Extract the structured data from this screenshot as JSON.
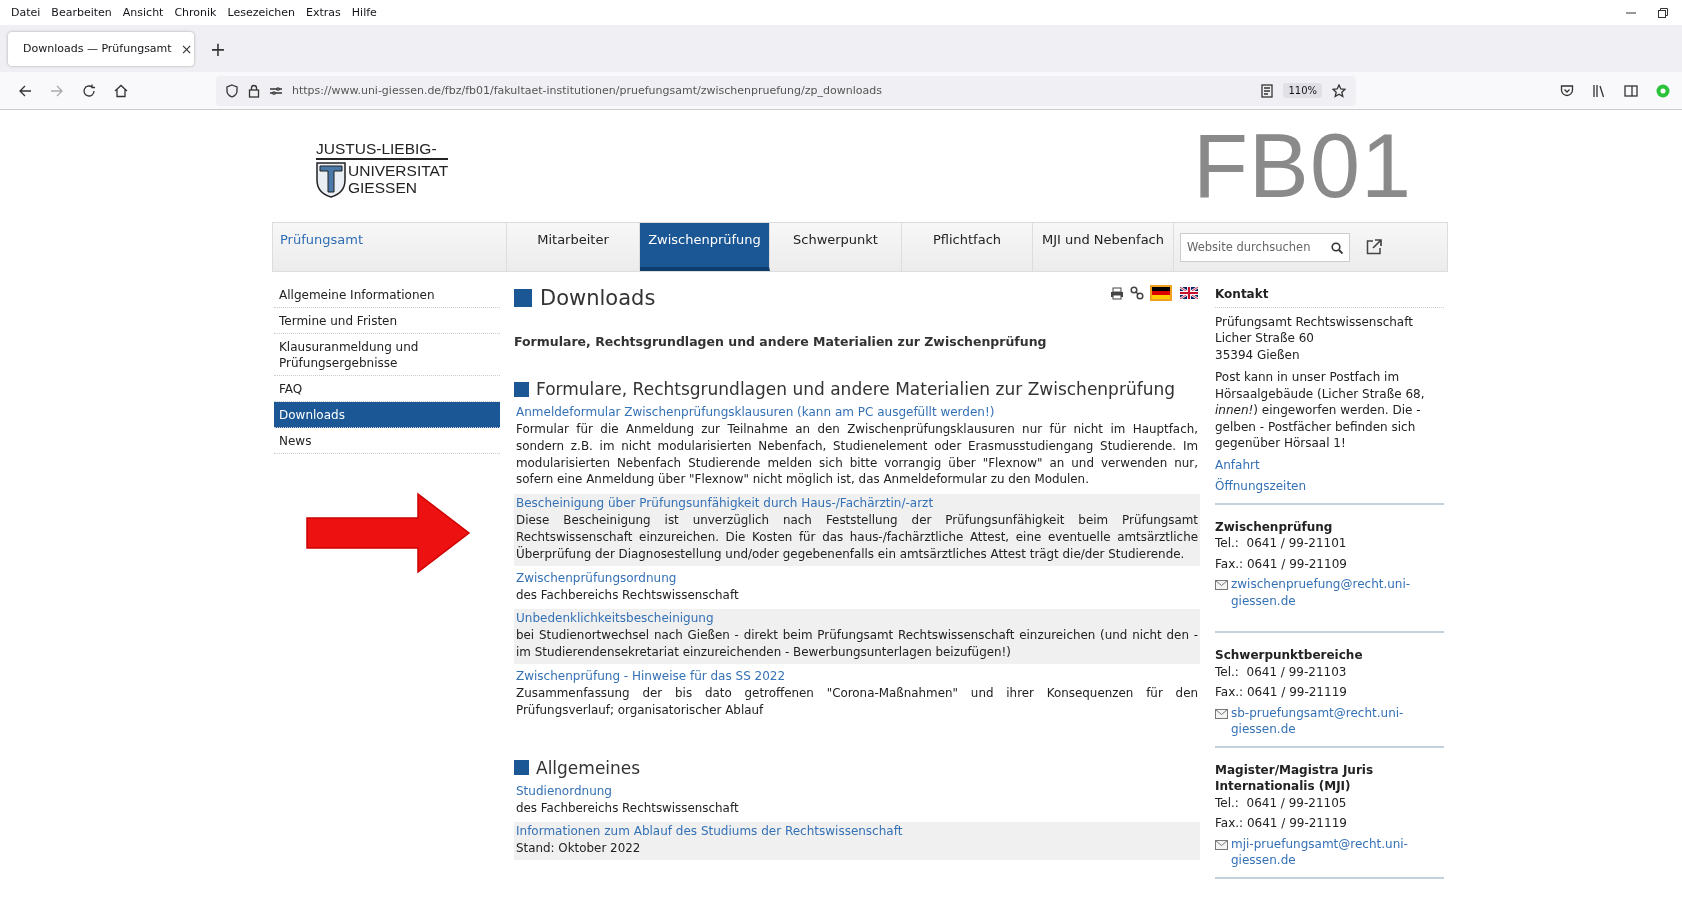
{
  "browser": {
    "menu": [
      "Datei",
      "Bearbeiten",
      "Ansicht",
      "Chronik",
      "Lesezeichen",
      "Extras",
      "Hilfe"
    ],
    "tab": {
      "title": "Downloads — Prüfungsamt",
      "close": "×",
      "selected": true
    },
    "new_tab": "+",
    "url": "https://www.uni-giessen.de/fbz/fb01/fakultaet-institutionen/pruefungsamt/zwischenpruefung/zp_downloads",
    "zoom": "110%"
  },
  "header": {
    "logo_lines": [
      "JUSTUS-LIEBIG-",
      "UNIVERSITAT",
      "GIESSEN"
    ],
    "department": "FB01"
  },
  "nav": {
    "items": [
      {
        "label": "Prüfungsamt",
        "kind": "home",
        "selected": false
      },
      {
        "label": "Mitarbeiter",
        "kind": "tab",
        "selected": false
      },
      {
        "label": "Zwischenprüfung",
        "kind": "tab",
        "selected": true
      },
      {
        "label": "Schwerpunkt",
        "kind": "tab",
        "selected": false
      },
      {
        "label": "Pflichtfach",
        "kind": "tab",
        "selected": false
      },
      {
        "label": "MJI und Nebenfach",
        "kind": "tab",
        "selected": false
      }
    ],
    "search": {
      "placeholder": "Website durchsuchen"
    }
  },
  "sidebar": {
    "items": [
      {
        "label": "Allgemeine Informationen",
        "selected": false
      },
      {
        "label": "Termine und Fristen",
        "selected": false
      },
      {
        "label": "Klausuranmeldung und Prüfungsergebnisse",
        "selected": false
      },
      {
        "label": "FAQ",
        "selected": false
      },
      {
        "label": "Downloads",
        "selected": true
      },
      {
        "label": "News",
        "selected": false
      }
    ]
  },
  "page": {
    "title": "Downloads",
    "languages": [
      {
        "kind": "de",
        "selected": true
      },
      {
        "kind": "en",
        "selected": false
      }
    ],
    "intro": "Formulare, Rechtsgrundlagen und andere Materialien zur Zwischenprüfung",
    "sections": [
      {
        "heading": "Formulare, Rechtsgrundlagen und andere Materialien zur Zwischenprüfung",
        "entries": [
          {
            "link": "Anmeldeformular Zwischenprüfungsklausuren (kann am PC ausgefüllt werden!)",
            "description": "Formular für die Anmeldung zur Teilnahme an den Zwischenprüfungsklausuren nur für nicht im Hauptfach, sondern z.B. im nicht modularisierten Nebenfach, Studienelement oder Erasmusstudiengang Studierende. Im modularisierten Nebenfach Studierende melden sich bitte vorrangig über \"Flexnow\" an und verwenden nur, sofern eine Anmeldung über \"Flexnow\" nicht möglich ist, das Anmeldeformular zu den Modulen."
          },
          {
            "link": "Bescheinigung über Prüfungsunfähigkeit durch Haus-/Fachärztin/-arzt",
            "description": "Diese Bescheinigung ist unverzüglich nach Feststellung der Prüfungsunfähigkeit beim Prüfungsamt Rechtswissenschaft einzureichen. Die Kosten für das haus-/fachärztliche Attest, eine eventuelle amtsärztliche Überprüfung der Diagnosestellung und/oder gegebenenfalls ein amtsärztliches Attest trägt die/der Studierende."
          },
          {
            "link": "Zwischenprüfungsordnung",
            "description": "des Fachbereichs Rechtswissenschaft"
          },
          {
            "link": "Unbedenklichkeitsbescheinigung",
            "description": "bei Studienortwechsel nach Gießen - direkt beim Prüfungsamt Rechtswissenschaft einzureichen (und nicht den - im Studierendensekretariat einzureichenden - Bewerbungsunterlagen beizufügen!)"
          },
          {
            "link": "Zwischenprüfung - Hinweise für das SS 2022",
            "description": "Zusammenfassung der bis dato getroffenen \"Corona-Maßnahmen\" und ihrer Konsequenzen für den Prüfungsverlauf; organisatorischer Ablauf"
          }
        ]
      },
      {
        "heading": "Allgemeines",
        "entries": [
          {
            "link": "Studienordnung",
            "description": "des Fachbereichs Rechtswissenschaft"
          },
          {
            "link": "Informationen zum Ablauf des Studiums der Rechtswissenschaft",
            "description": "Stand: Oktober 2022"
          }
        ]
      }
    ]
  },
  "contact": {
    "title": "Kontakt",
    "address": [
      "Prüfungsamt Rechtswissenschaft",
      "Licher Straße 60",
      "35394 Gießen"
    ],
    "note": "Post kann in unser Postfach im Hörsaalgebäude (Licher Straße 68, *innen!*) eingeworfen werden. Die - gelben - Postfächer befinden sich gegenüber Hörsaal 1!",
    "links": [
      "Anfahrt",
      "Öffnungszeiten"
    ],
    "offices": [
      {
        "title": "Zwischenprüfung",
        "tel": "Tel.:  0641 / 99-21101",
        "fax": "Fax.: 0641 / 99-21109",
        "email": "zwischenpruefung@recht.uni-giessen.de"
      },
      {
        "title": "Schwerpunktbereiche",
        "tel": "Tel.:  0641 / 99-21103",
        "fax": "Fax.: 0641 / 99-21119",
        "email": "sb-pruefungsamt@recht.uni-giessen.de"
      },
      {
        "title": "Magister/Magistra Juris Internationalis (MJI)",
        "tel": "Tel.:  0641 / 99-21105",
        "fax": "Fax.: 0641 / 99-21119",
        "email": "mji-pruefungsamt@recht.uni-giessen.de"
      }
    ]
  }
}
